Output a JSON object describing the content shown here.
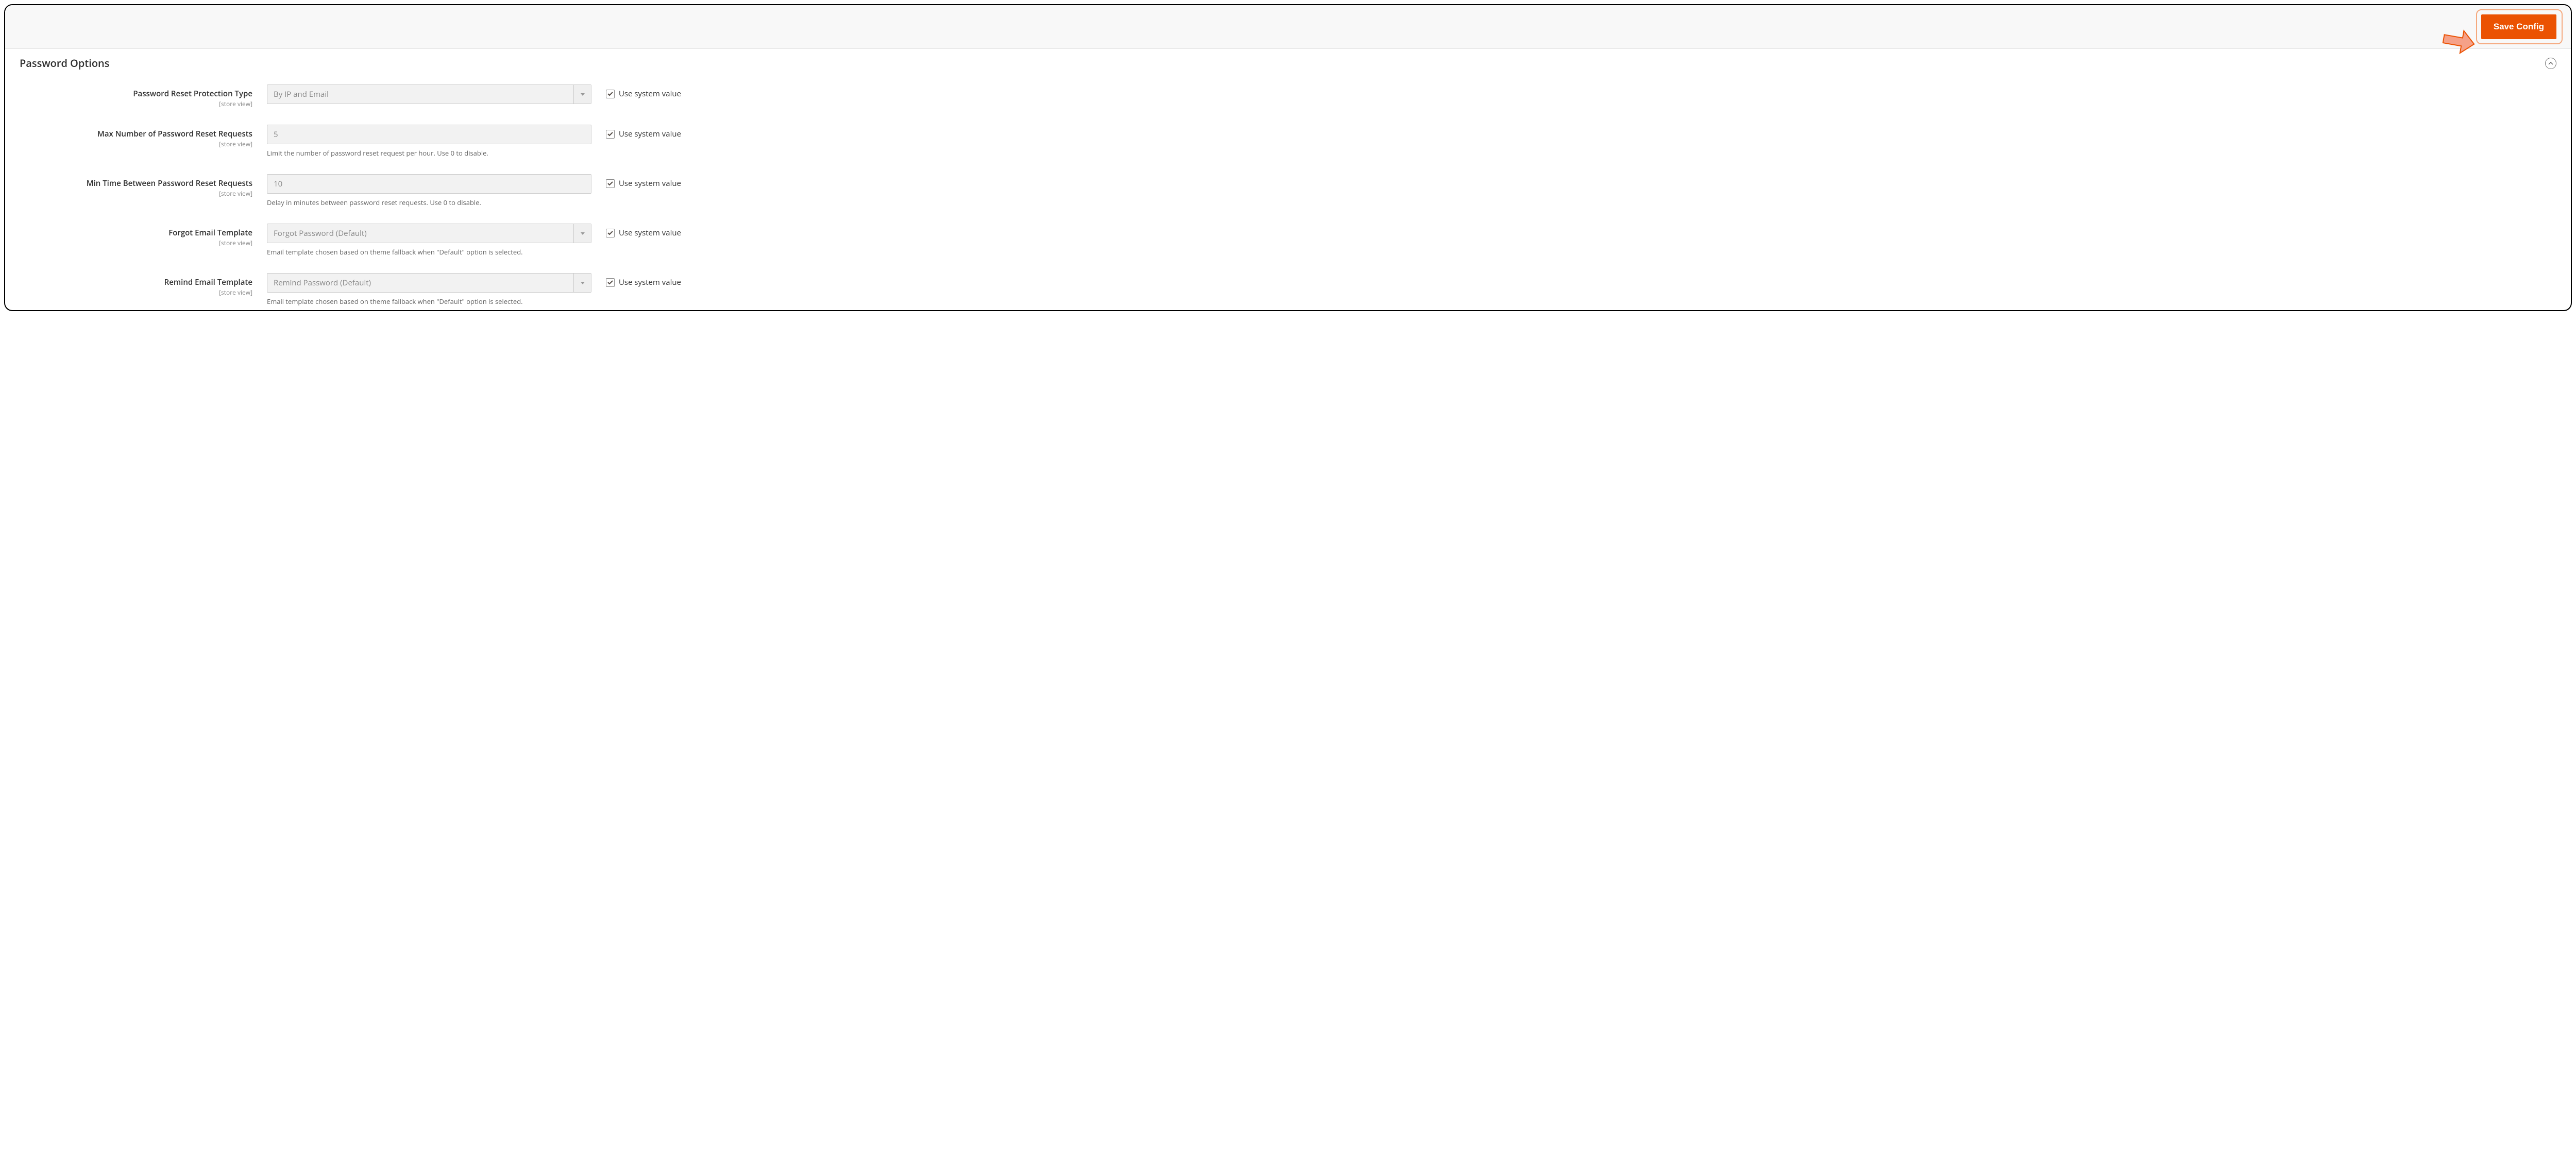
{
  "header": {
    "save_label": "Save Config"
  },
  "section": {
    "title": "Password Options"
  },
  "common": {
    "scope": "[store view]",
    "use_system": "Use system value"
  },
  "fields": {
    "protection_type": {
      "label": "Password Reset Protection Type",
      "value": "By IP and Email"
    },
    "max_requests": {
      "label": "Max Number of Password Reset Requests",
      "value": "5",
      "hint": "Limit the number of password reset request per hour. Use 0 to disable."
    },
    "min_time": {
      "label": "Min Time Between Password Reset Requests",
      "value": "10",
      "hint": "Delay in minutes between password reset requests. Use 0 to disable."
    },
    "forgot_template": {
      "label": "Forgot Email Template",
      "value": "Forgot Password (Default)",
      "hint": "Email template chosen based on theme fallback when \"Default\" option is selected."
    },
    "remind_template": {
      "label": "Remind Email Template",
      "value": "Remind Password (Default)",
      "hint": "Email template chosen based on theme fallback when \"Default\" option is selected."
    }
  }
}
